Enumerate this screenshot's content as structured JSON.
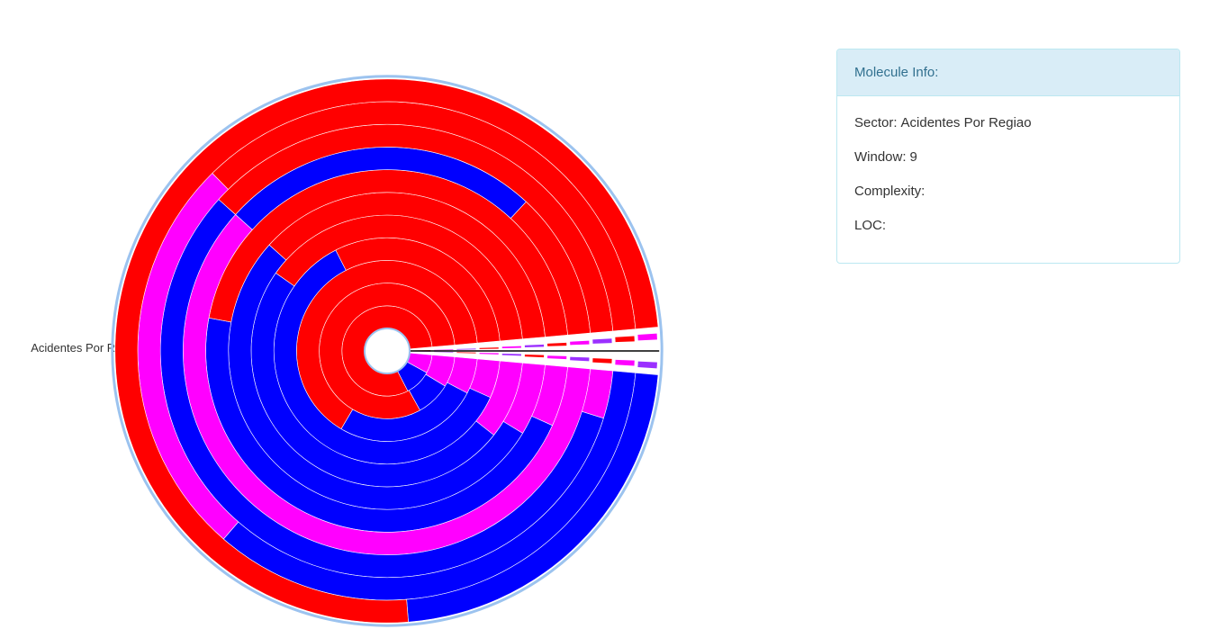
{
  "chart": {
    "sector_label": "Acidentes Por Regiao"
  },
  "colors": {
    "red": "#ff0000",
    "blue": "#0000ff",
    "magenta": "#ff00ff",
    "purple": "#9b30ff",
    "ring_outline": "#9cc3ef"
  },
  "panel": {
    "title": "Molecule Info:",
    "sector_label": "Sector:",
    "sector_value": "Acidentes Por Regiao",
    "window_label": "Window:",
    "window_value": "9",
    "complexity_label": "Complexity:",
    "complexity_value": "",
    "loc_label": "LOC:",
    "loc_value": ""
  },
  "chart_data": {
    "type": "radial-window",
    "direction": "clockwise-from-east",
    "rings": [
      {
        "ring": 1,
        "segments": [
          {
            "color": "magenta",
            "end": 0.068
          },
          {
            "color": "blue",
            "end": 0.165
          },
          {
            "color": "red",
            "end": 1.0
          }
        ]
      },
      {
        "ring": 2,
        "segments": [
          {
            "color": "magenta",
            "end": 0.075
          },
          {
            "color": "blue",
            "end": 0.16
          },
          {
            "color": "red",
            "end": 1.0
          }
        ]
      },
      {
        "ring": 3,
        "segments": [
          {
            "color": "magenta",
            "end": 0.065
          },
          {
            "color": "blue",
            "end": 0.33
          },
          {
            "color": "red",
            "end": 1.0
          }
        ]
      },
      {
        "ring": 4,
        "segments": [
          {
            "color": "magenta",
            "end": 0.055
          },
          {
            "color": "blue",
            "end": 0.68
          },
          {
            "color": "red",
            "end": 1.0
          }
        ]
      },
      {
        "ring": 5,
        "segments": [
          {
            "color": "magenta",
            "end": 0.095
          },
          {
            "color": "blue",
            "end": 0.6
          },
          {
            "color": "red",
            "end": 1.0
          }
        ]
      },
      {
        "ring": 6,
        "segments": [
          {
            "color": "magenta",
            "end": 0.075
          },
          {
            "color": "blue",
            "end": 0.62
          },
          {
            "color": "red",
            "end": 1.0
          }
        ]
      },
      {
        "ring": 7,
        "segments": [
          {
            "color": "magenta",
            "end": 0.055
          },
          {
            "color": "blue",
            "end": 0.53
          },
          {
            "color": "red",
            "end": 1.0
          }
        ]
      },
      {
        "ring": 8,
        "segments": [
          {
            "color": "magenta",
            "end": 0.62
          },
          {
            "color": "blue",
            "end": 0.88
          },
          {
            "color": "red",
            "end": 1.0
          }
        ]
      },
      {
        "ring": 9,
        "segments": [
          {
            "color": "magenta",
            "end": 0.035
          },
          {
            "color": "blue",
            "end": 0.62
          },
          {
            "color": "red",
            "end": 1.0
          }
        ]
      },
      {
        "ring": 10,
        "segments": [
          {
            "color": "blue",
            "end": 0.36
          },
          {
            "color": "magenta",
            "end": 0.63
          },
          {
            "color": "red",
            "end": 1.0
          }
        ]
      },
      {
        "ring": 11,
        "segments": [
          {
            "color": "blue",
            "end": 0.23
          },
          {
            "color": "red",
            "end": 1.0
          }
        ]
      }
    ]
  }
}
